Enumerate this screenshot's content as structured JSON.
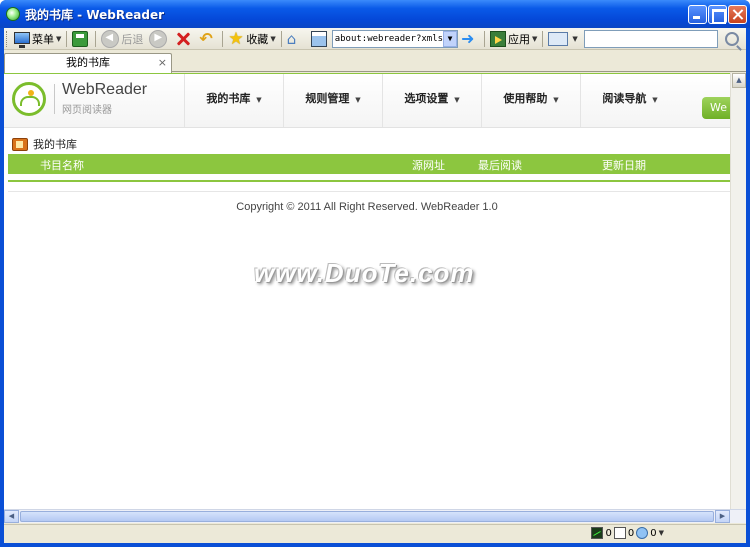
{
  "window": {
    "title": "我的书库 - WebReader"
  },
  "toolbar": {
    "menu_label": "菜单",
    "back_label": "后退",
    "favorites_label": "收藏",
    "address_value": "about:webreader?xmls=i",
    "apps_label": "应用",
    "search_value": ""
  },
  "tabs": [
    {
      "label": "我的书库",
      "close": "×"
    }
  ],
  "site": {
    "logo_title": "WebReader",
    "logo_subtitle": "网页阅读器",
    "nav": [
      {
        "label": "我的书库"
      },
      {
        "label": "规则管理"
      },
      {
        "label": "选项设置"
      },
      {
        "label": "使用帮助"
      },
      {
        "label": "阅读导航"
      }
    ],
    "nav_button": "We",
    "section_title": "我的书库",
    "columns": [
      "书目名称",
      "源网址",
      "最后阅读",
      "更新日期"
    ],
    "copyright": "Copyright © 2011 All Right Reserved. WebReader 1.0"
  },
  "watermark": "www.DuoTe.com",
  "status": {
    "counts": [
      "0",
      "0",
      "0"
    ]
  },
  "colors": {
    "accent_green": "#8cc63f",
    "titlebar_blue": "#0a5ae8"
  }
}
